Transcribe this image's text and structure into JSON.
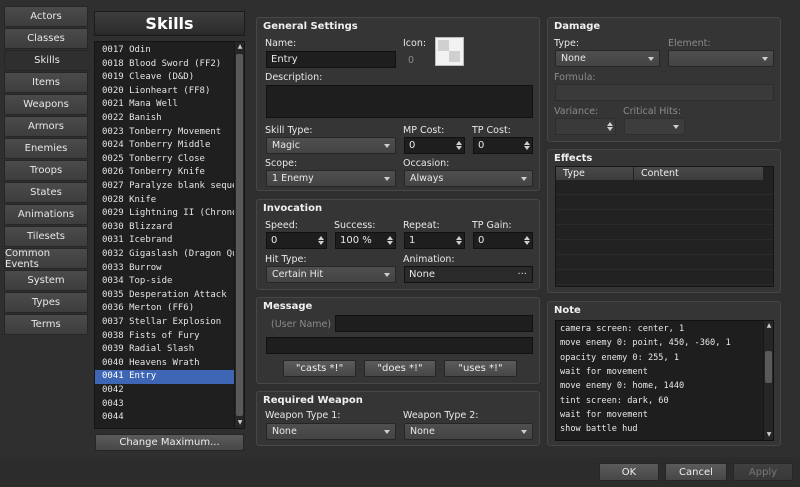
{
  "tabs": [
    "Actors",
    "Classes",
    "Skills",
    "Items",
    "Weapons",
    "Armors",
    "Enemies",
    "Troops",
    "States",
    "Animations",
    "Tilesets",
    "Common Events",
    "System",
    "Types",
    "Terms"
  ],
  "active_tab": "Skills",
  "list_title": "Skills",
  "skills": [
    "0017 Odin",
    "0018 Blood Sword (FF2)",
    "0019 Cleave (D&D)",
    "0020 Lionheart (FF8)",
    "0021 Mana Well",
    "0022 Banish",
    "0023 Tonberry Movement",
    "0024 Tonberry Middle",
    "0025 Tonberry Close",
    "0026 Tonberry Knife",
    "0027 Paralyze blank seque…",
    "0028 Knife",
    "0029 Lightning II (Chrono…",
    "0030 Blizzard",
    "0031 Icebrand",
    "0032 Gigaslash (Dragon Qu…",
    "0033 Burrow",
    "0034 Top-side",
    "0035 Desperation Attack",
    "0036 Merton (FF6)",
    "0037 Stellar Explosion",
    "0038 Fists of Fury",
    "0039 Radial Slash",
    "0040 Heavens Wrath",
    "0041 Entry",
    "0042",
    "0043",
    "0044"
  ],
  "selected_skill_index": 24,
  "change_maximum_label": "Change Maximum...",
  "general": {
    "title": "General Settings",
    "name_label": "Name:",
    "name_value": "Entry",
    "icon_label": "Icon:",
    "icon_index": "0",
    "description_label": "Description:",
    "description_value": "",
    "skill_type_label": "Skill Type:",
    "skill_type_value": "Magic",
    "mp_cost_label": "MP Cost:",
    "mp_cost_value": "0",
    "tp_cost_label": "TP Cost:",
    "tp_cost_value": "0",
    "scope_label": "Scope:",
    "scope_value": "1 Enemy",
    "occasion_label": "Occasion:",
    "occasion_value": "Always"
  },
  "invocation": {
    "title": "Invocation",
    "speed_label": "Speed:",
    "speed_value": "0",
    "success_label": "Success:",
    "success_value": "100 %",
    "repeat_label": "Repeat:",
    "repeat_value": "1",
    "tp_gain_label": "TP Gain:",
    "tp_gain_value": "0",
    "hit_type_label": "Hit Type:",
    "hit_type_value": "Certain Hit",
    "animation_label": "Animation:",
    "animation_value": "None"
  },
  "message": {
    "title": "Message",
    "user_name_placeholder": "(User Name)",
    "line1": "",
    "line2": "",
    "btn_casts": "\"casts *!\"",
    "btn_does": "\"does *!\"",
    "btn_uses": "\"uses *!\""
  },
  "required_weapon": {
    "title": "Required Weapon",
    "type1_label": "Weapon Type 1:",
    "type1_value": "None",
    "type2_label": "Weapon Type 2:",
    "type2_value": "None"
  },
  "damage": {
    "title": "Damage",
    "type_label": "Type:",
    "type_value": "None",
    "element_label": "Element:",
    "element_value": "",
    "formula_label": "Formula:",
    "formula_value": "",
    "variance_label": "Variance:",
    "variance_value": "",
    "critical_label": "Critical Hits:",
    "critical_value": ""
  },
  "effects": {
    "title": "Effects",
    "col_type": "Type",
    "col_content": "Content"
  },
  "note": {
    "title": "Note",
    "lines": [
      "camera screen: center, 1",
      "move enemy 0: point, 450, -360, 1",
      "opacity enemy 0: 255, 1",
      "wait for movement",
      "move enemy 0: home, 1440",
      "tint screen: dark, 60",
      "wait for movement",
      "show battle hud"
    ]
  },
  "footer": {
    "ok": "OK",
    "cancel": "Cancel",
    "apply": "Apply"
  }
}
